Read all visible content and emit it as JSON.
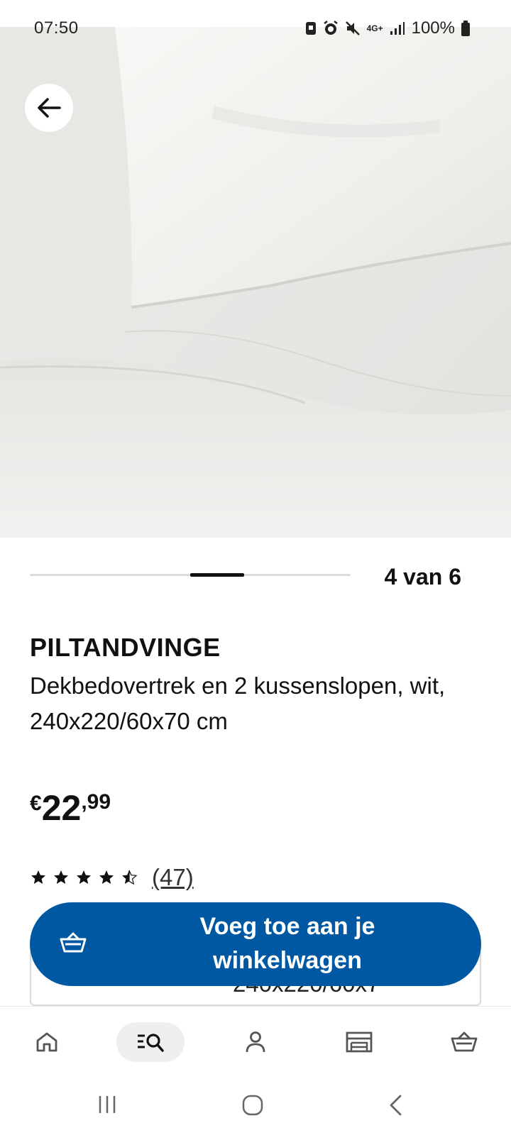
{
  "status_bar": {
    "time": "07:50",
    "network": "4G+",
    "battery": "100%"
  },
  "product": {
    "image_alt": "Wit dekbedovertrek met kussensloop",
    "gallery": {
      "current": 4,
      "total": 6,
      "counter_text": "4 van 6"
    },
    "name": "PILTANDVINGE",
    "description": "Dekbedovertrek en 2 kussenslopen, wit, 240x220/60x70 cm",
    "price": {
      "currency": "€",
      "integer": "22",
      "decimal": ",99"
    },
    "rating": {
      "stars": 4.5,
      "max": 5,
      "review_count": "(47)"
    },
    "option_size": "240x220/60x7"
  },
  "actions": {
    "add_to_cart_label": "Voeg toe aan je winkelwagen"
  },
  "bottom_nav": {
    "items": [
      {
        "icon": "home-icon",
        "active": false
      },
      {
        "icon": "browse-search-icon",
        "active": true
      },
      {
        "icon": "profile-icon",
        "active": false
      },
      {
        "icon": "store-icon",
        "active": false
      },
      {
        "icon": "cart-icon",
        "active": false
      }
    ]
  },
  "colors": {
    "accent": "#0058a3",
    "text": "#111111",
    "nav_active_bg": "#efefef"
  }
}
